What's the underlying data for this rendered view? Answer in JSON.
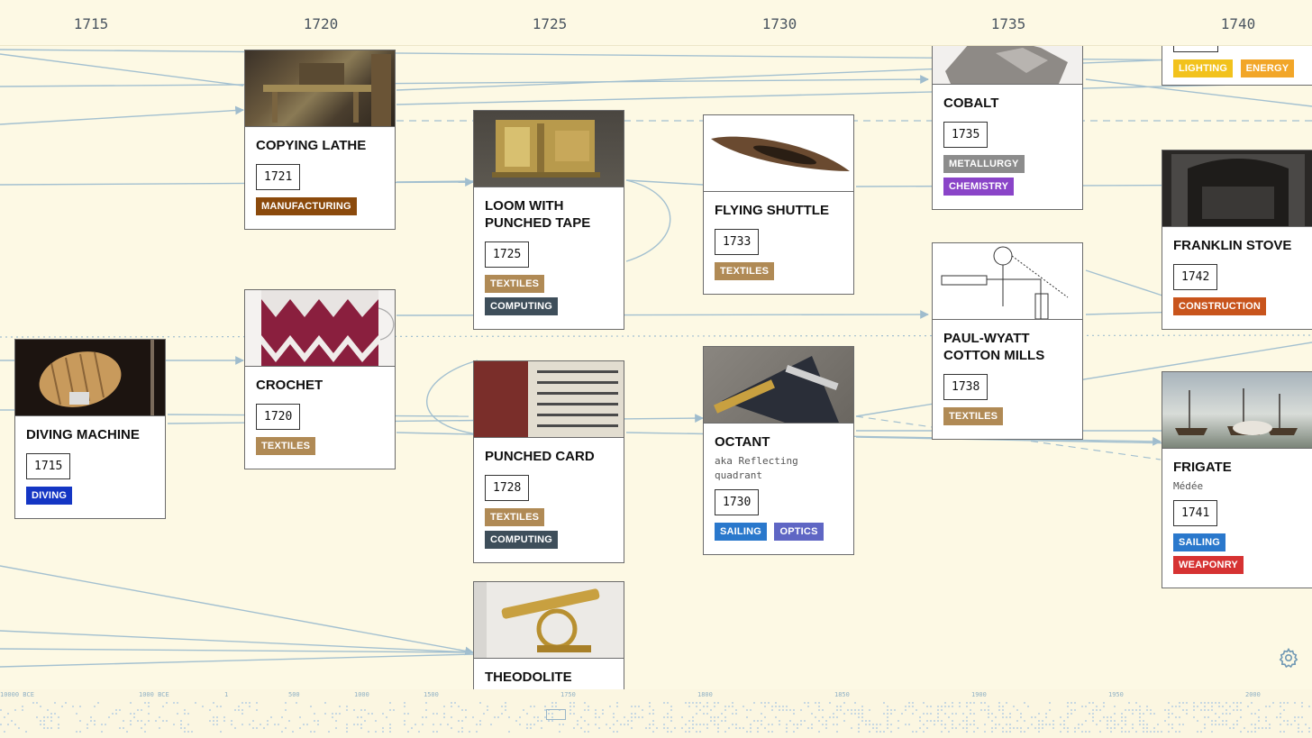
{
  "years": [
    "1715",
    "1720",
    "1725",
    "1730",
    "1735",
    "1740"
  ],
  "cards": [
    {
      "id": "copying-lathe",
      "title": "Copying lathe",
      "year": "1721",
      "aka": "",
      "tags": [
        {
          "label": "Manufacturing",
          "color": "#8b4a0c"
        }
      ]
    },
    {
      "id": "crochet",
      "title": "Crochet",
      "year": "1720",
      "aka": "",
      "tags": [
        {
          "label": "Textiles",
          "color": "#b08a55"
        }
      ]
    },
    {
      "id": "diving-machine",
      "title": "Diving machine",
      "year": "1715",
      "aka": "",
      "tags": [
        {
          "label": "Diving",
          "color": "#1436c4"
        }
      ]
    },
    {
      "id": "loom",
      "title": "Loom with punched tape",
      "year": "1725",
      "aka": "",
      "tags": [
        {
          "label": "Textiles",
          "color": "#b08a55"
        },
        {
          "label": "Computing",
          "color": "#3e4e5a"
        }
      ]
    },
    {
      "id": "punched-card",
      "title": "Punched card",
      "year": "1728",
      "aka": "",
      "tags": [
        {
          "label": "Textiles",
          "color": "#b08a55"
        },
        {
          "label": "Computing",
          "color": "#3e4e5a"
        }
      ]
    },
    {
      "id": "theodolite",
      "title": "Theodolite",
      "year": "",
      "aka": "",
      "tags": []
    },
    {
      "id": "flying-shuttle",
      "title": "Flying shuttle",
      "year": "1733",
      "aka": "",
      "tags": [
        {
          "label": "Textiles",
          "color": "#b08a55"
        }
      ]
    },
    {
      "id": "octant",
      "title": "Octant",
      "year": "1730",
      "aka": "aka Reflecting quadrant",
      "tags": [
        {
          "label": "Sailing",
          "color": "#2a78cc"
        },
        {
          "label": "Optics",
          "color": "#5f66c4"
        }
      ]
    },
    {
      "id": "cobalt",
      "title": "Cobalt",
      "year": "1735",
      "aka": "",
      "tags": [
        {
          "label": "Metallurgy",
          "color": "#8c8c8c"
        },
        {
          "label": "Chemistry",
          "color": "#8a44c8"
        }
      ]
    },
    {
      "id": "cotton-mills",
      "title": "Paul-Wyatt cotton mills",
      "year": "1738",
      "aka": "",
      "tags": [
        {
          "label": "Textiles",
          "color": "#b08a55"
        }
      ]
    },
    {
      "id": "lighting-energy",
      "title": "",
      "year": "",
      "aka": "",
      "tags": [
        {
          "label": "Lighting",
          "color": "#f2c21c"
        },
        {
          "label": "Energy",
          "color": "#f2a628"
        }
      ]
    },
    {
      "id": "franklin-stove",
      "title": "Franklin stove",
      "year": "1742",
      "aka": "",
      "tags": [
        {
          "label": "Construction",
          "color": "#c8541c"
        }
      ]
    },
    {
      "id": "frigate",
      "title": "Frigate",
      "year": "1741",
      "aka": "Médée",
      "tags": [
        {
          "label": "Sailing",
          "color": "#2a78cc"
        },
        {
          "label": "Weaponry",
          "color": "#d63232"
        }
      ]
    }
  ],
  "minimap": {
    "labels": [
      "10000 BCE",
      "1000 BCE",
      "1",
      "500",
      "1000",
      "1500",
      "1750",
      "1800",
      "1850",
      "1900",
      "1950",
      "2000"
    ]
  },
  "settings_icon": "gear-icon"
}
